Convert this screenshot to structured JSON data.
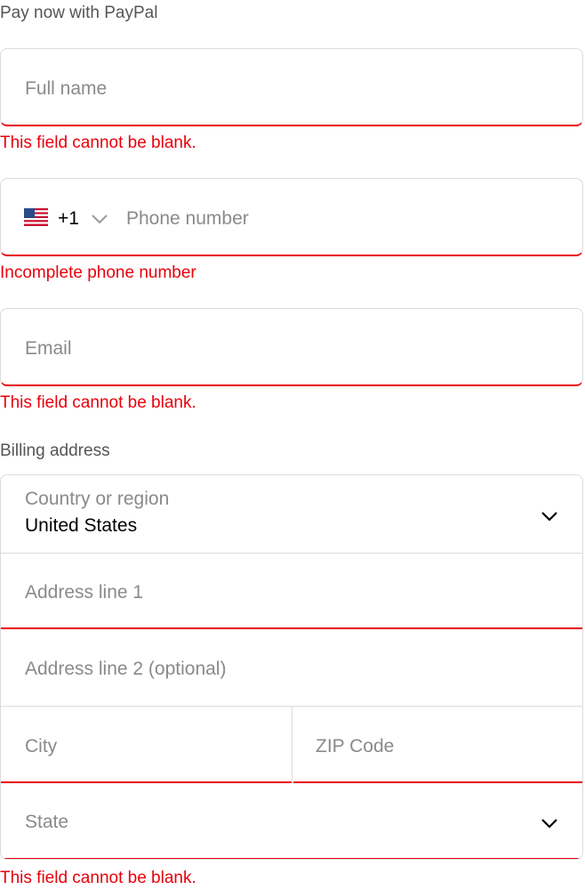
{
  "header": {
    "pay_label": "Pay now with PayPal"
  },
  "full_name": {
    "placeholder": "Full name",
    "error": "This field cannot be blank."
  },
  "phone": {
    "country_code": "+1",
    "flag_icon": "us-flag-icon",
    "placeholder": "Phone number",
    "error": "Incomplete phone number"
  },
  "email": {
    "placeholder": "Email",
    "error": "This field cannot be blank."
  },
  "billing": {
    "label": "Billing address",
    "country_label": "Country or region",
    "country_value": "United States",
    "address1_placeholder": "Address line 1",
    "address2_placeholder": "Address line 2 (optional)",
    "city_placeholder": "City",
    "zip_placeholder": "ZIP Code",
    "state_placeholder": "State",
    "error": "This field cannot be blank."
  },
  "colors": {
    "error": "#e8000b",
    "border": "#dcdcdc",
    "placeholder": "#8a8a8a"
  }
}
